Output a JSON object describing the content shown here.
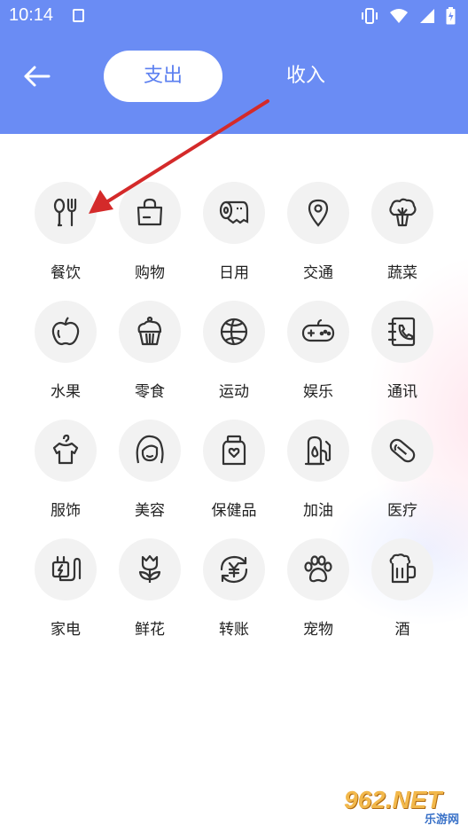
{
  "status_bar": {
    "time": "10:14"
  },
  "tabs": {
    "expense": "支出",
    "income": "收入"
  },
  "categories": [
    {
      "label": "餐饮",
      "icon": "utensils-icon"
    },
    {
      "label": "购物",
      "icon": "shopping-bag-icon"
    },
    {
      "label": "日用",
      "icon": "toilet-paper-icon"
    },
    {
      "label": "交通",
      "icon": "location-pin-icon"
    },
    {
      "label": "蔬菜",
      "icon": "vegetable-icon"
    },
    {
      "label": "水果",
      "icon": "apple-icon"
    },
    {
      "label": "零食",
      "icon": "cupcake-icon"
    },
    {
      "label": "运动",
      "icon": "basketball-icon"
    },
    {
      "label": "娱乐",
      "icon": "gamepad-icon"
    },
    {
      "label": "通讯",
      "icon": "phone-book-icon"
    },
    {
      "label": "服饰",
      "icon": "shirt-hanger-icon"
    },
    {
      "label": "美容",
      "icon": "woman-face-icon"
    },
    {
      "label": "保健品",
      "icon": "supplement-jar-icon"
    },
    {
      "label": "加油",
      "icon": "fuel-pump-icon"
    },
    {
      "label": "医疗",
      "icon": "pill-icon"
    },
    {
      "label": "家电",
      "icon": "power-plug-icon"
    },
    {
      "label": "鲜花",
      "icon": "flower-icon"
    },
    {
      "label": "转账",
      "icon": "yuan-transfer-icon"
    },
    {
      "label": "宠物",
      "icon": "paw-icon"
    },
    {
      "label": "酒",
      "icon": "beer-mug-icon"
    }
  ],
  "colors": {
    "header": "#6a8cf4",
    "active_tab_text": "#5b7ff0",
    "arrow": "#d42a2a"
  },
  "watermark": {
    "main": "962.NET",
    "sub": "乐游网"
  }
}
